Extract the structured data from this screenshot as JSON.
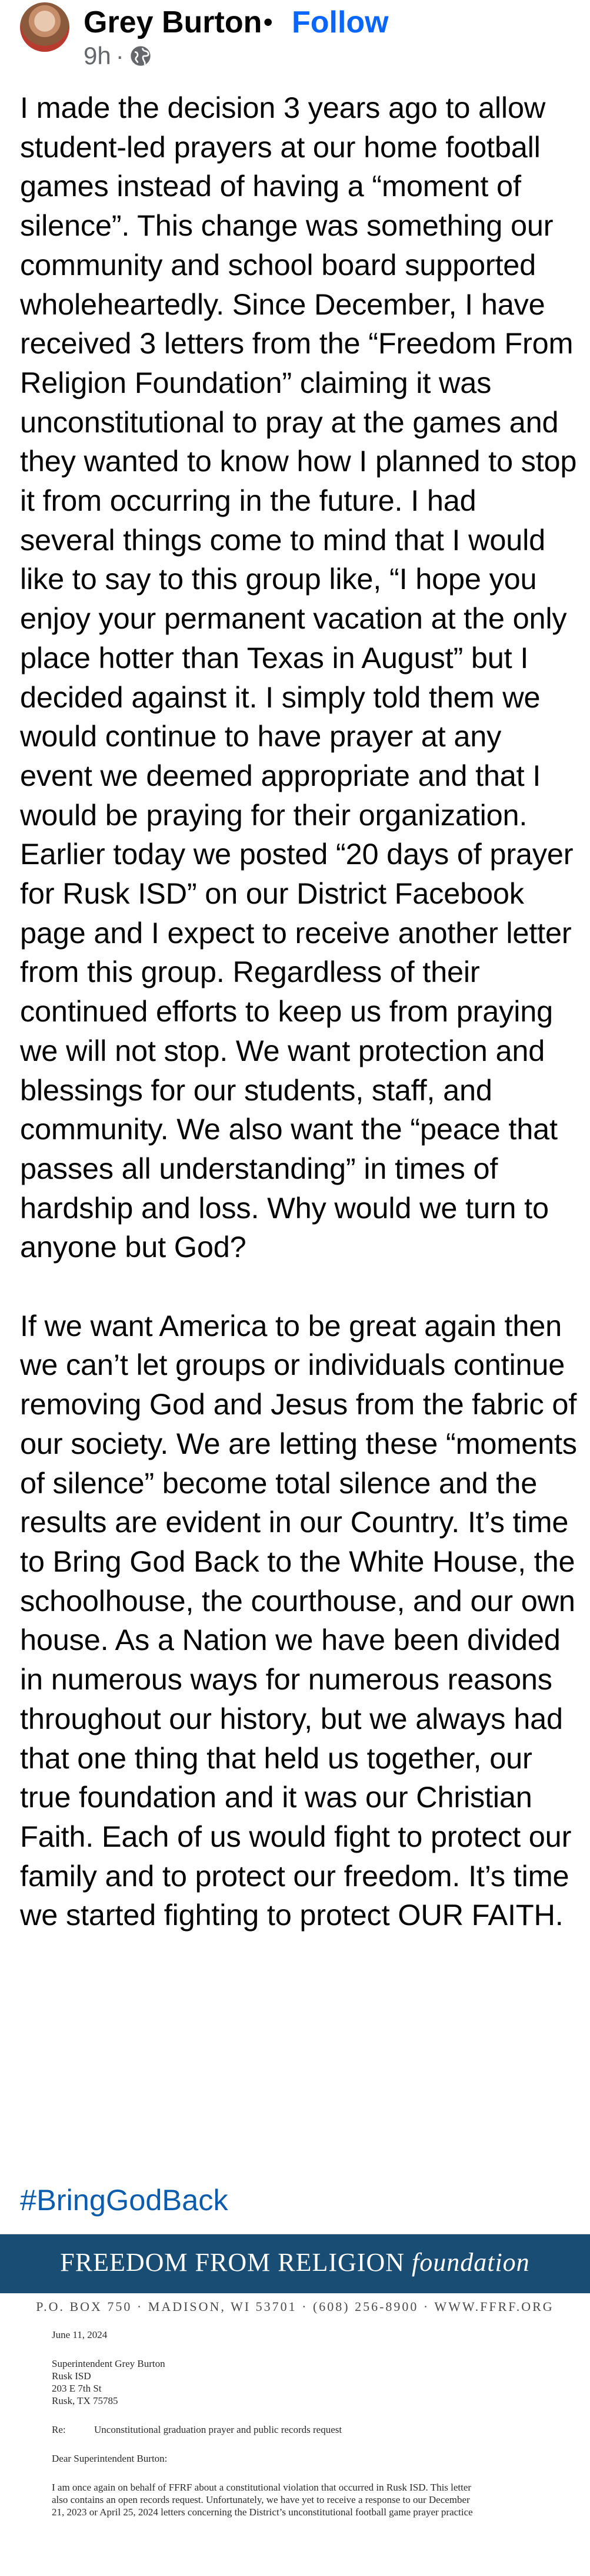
{
  "post": {
    "author": "Grey Burton",
    "separator": "•",
    "follow_label": "Follow",
    "time": "9h",
    "meta_dot": "·",
    "privacy_icon": "globe-icon",
    "paragraphs": [
      "I made the decision 3 years ago to allow student-led prayers at our home football games instead of having a “moment of silence”. This change was something our community and school board supported wholeheartedly. Since December, I have received 3 letters from the “Freedom From Religion Foundation” claiming it was unconstitutional to pray at the games and they wanted to know how I planned to stop it from occurring in the future. I had several things come to mind that I would like to say to this group like, “I hope you enjoy your permanent vacation at the only place hotter than Texas in August” but I decided against it. I simply told them we would continue to have prayer at any event we deemed appropriate and that I would be praying for their organization. Earlier today we posted “20 days of prayer for Rusk ISD” on our District Facebook page and I expect to receive another letter from this group. Regardless of their continued efforts to keep us from praying we will not stop. We want protection and blessings for our students, staff, and community. We also want the “peace that passes all understanding” in times of hardship and loss. Why would we turn to anyone but God?",
      "If we want America to be great again then we can’t let groups or individuals continue removing God and Jesus from the fabric of our society. We are letting these “moments of silence” become total silence and the results are evident in our Country. It’s time to Bring God Back to the White House, the schoolhouse, the courthouse, and our own house. As a Nation we have been divided in numerous ways for numerous reasons throughout our history, but we always had that one thing that held us together, our true foundation and it was our Christian Faith. Each of us would fight to protect our family and to protect our freedom. It’s time we started fighting to protect OUR FAITH."
    ],
    "hashtag": "#BringGodBack"
  },
  "letter": {
    "org_name_caps": "FREEDOM FROM RELIGION",
    "org_name_italic": "foundation",
    "address_line": "P.O. BOX 750 · MADISON, WI 53701 · (608) 256-8900 · WWW.FFRF.ORG",
    "date": "June 11, 2024",
    "recipient": [
      "Superintendent Grey Burton",
      "Rusk ISD",
      "203 E 7th St",
      "Rusk, TX 75785"
    ],
    "re_label": "Re:",
    "re_subject": "Unconstitutional graduation prayer and public records request",
    "salutation": "Dear Superintendent Burton:",
    "body_lines": [
      "I am  once again on behalf of FFRF about a constitutional violation that occurred in Rusk ISD. This letter",
      "also contains an open records request. Unfortunately, we have yet to receive a response to our December",
      "21, 2023 or April 25, 2024 letters concerning the District’s unconstitutional football game prayer practice"
    ],
    "colors": {
      "band": "#1a4d73",
      "link": "#0866ff",
      "hashtag": "#0b5cad"
    }
  }
}
